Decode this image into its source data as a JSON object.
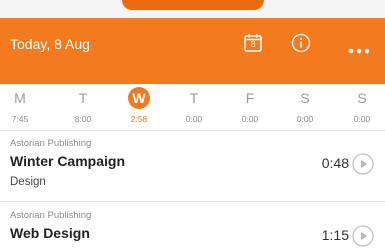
{
  "header": {
    "title": "Today, 8 Aug",
    "calendar_day": "8",
    "icons": [
      "calendar-icon",
      "info-icon",
      "more-icon"
    ],
    "accent_color": "#f37a1f"
  },
  "week": {
    "days": [
      {
        "letter": "M",
        "total": "7:45",
        "active": false
      },
      {
        "letter": "T",
        "total": "8:00",
        "active": false
      },
      {
        "letter": "W",
        "total": "2:58",
        "active": true
      },
      {
        "letter": "T",
        "total": "0:00",
        "active": false
      },
      {
        "letter": "F",
        "total": "0:00",
        "active": false
      },
      {
        "letter": "S",
        "total": "0:00",
        "active": false
      },
      {
        "letter": "S",
        "total": "0:00",
        "active": false
      }
    ]
  },
  "entries": [
    {
      "client": "Astorian Publishing",
      "project": "Winter Campaign",
      "task": "Design",
      "duration": "0:48"
    },
    {
      "client": "Astorian Publishing",
      "project": "Web Design",
      "task": "",
      "duration": "1:15"
    }
  ]
}
